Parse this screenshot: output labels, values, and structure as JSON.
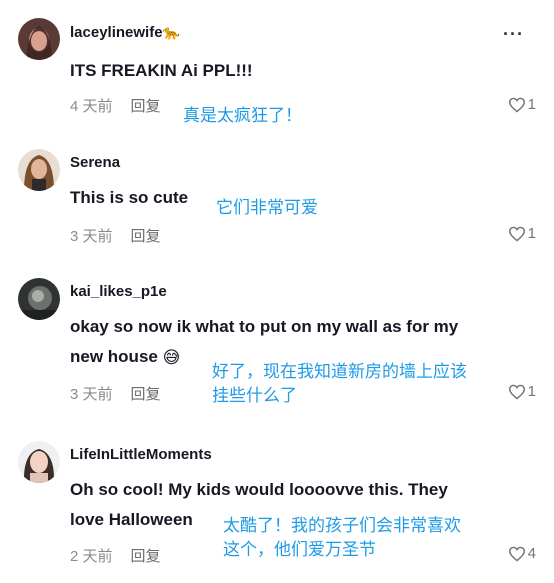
{
  "comments": [
    {
      "username": "laceylinewife",
      "username_emoji": "🐆",
      "text": "ITS FREAKIN Ai PPL!!!",
      "time": "4 天前",
      "reply": "回复",
      "likes": "1",
      "translation": "真是太疯狂了！"
    },
    {
      "username": "Serena",
      "text": "This is so cute",
      "time": "3 天前",
      "reply": "回复",
      "likes": "1",
      "translation": "它们非常可爱"
    },
    {
      "username": "kai_likes_p1e",
      "text_line1": "okay so now ik what to put on my wall as for my",
      "text_line2": "new house",
      "text_emoji": "😅",
      "time": "3 天前",
      "reply": "回复",
      "likes": "1",
      "translation_line1": "好了，现在我知道新房的墙上应该",
      "translation_line2": "挂些什么了"
    },
    {
      "username": "LifeInLittleMoments",
      "text_line1": "Oh so cool! My kids would loooovve this. They",
      "text_line2": "love Halloween",
      "time": "2 天前",
      "reply": "回复",
      "likes": "4",
      "translation_line1": "太酷了！我的孩子们会非常喜欢",
      "translation_line2": "这个，他们爱万圣节"
    }
  ],
  "more_label": "···",
  "icons": {
    "like": "heart-outline-icon",
    "more": "more-dots-icon"
  },
  "colors": {
    "translation": "#1e9be6",
    "meta": "#8a8b91",
    "text": "#161823"
  }
}
